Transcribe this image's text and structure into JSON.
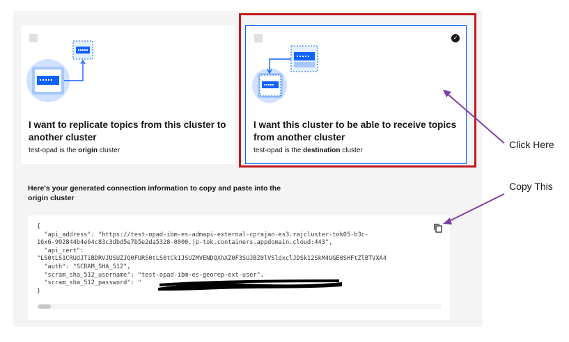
{
  "tiles": [
    {
      "title_line1": "I want to replicate topics from this cluster to",
      "title_line2": "another cluster",
      "sub_prefix": "test-opad is the ",
      "sub_bold": "origin",
      "sub_suffix": " cluster",
      "selected": false
    },
    {
      "title_line1": "I want this cluster to be able to receive topics",
      "title_line2": "from another cluster",
      "sub_prefix": "test-opad is the ",
      "sub_bold": "destination",
      "sub_suffix": " cluster",
      "selected": true
    }
  ],
  "connection": {
    "heading_line1": "Here's your generated connection information to copy and paste into the",
    "heading_line2": "origin cluster",
    "code_lines": [
      "{",
      "  \"api_address\": \"https://test-opad-ibm-es-admapi-external-cprajan-es3.rajcluster-tok05-b3c-",
      "16x6-992844b4e64c83c3dbd5e7b5e2da5328-0000.jp-tok.containers.appdomain.cloud:443\",",
      "  \"api_cert\":",
      "\"LS0tLS1CRUdJTiBDRVJUSUZJQ0FURS0tLS0tCk1JSUZMVENDQXhXZ0F3SUJBZ0lVSldxclJDSk12SkM4UGE0SHFtZlBTVXA4",
      "  \"auth\": \"SCRAM_SHA_512\",",
      "  \"scram_sha_512_username\": \"test-opad-ibm-es-georep-ext-user\",",
      "  \"scram_sha_512_password\": \"                                  \"",
      "}"
    ]
  },
  "annotations": {
    "click_here": "Click Here",
    "copy_this": "Copy This"
  },
  "colors": {
    "selection_border": "#0f62fe",
    "highlight_box": "#c0171f",
    "annotation_arrow": "#7b3fa8"
  },
  "icons": {
    "checkmark": "checkmark-filled-icon",
    "copy": "copy-icon"
  }
}
